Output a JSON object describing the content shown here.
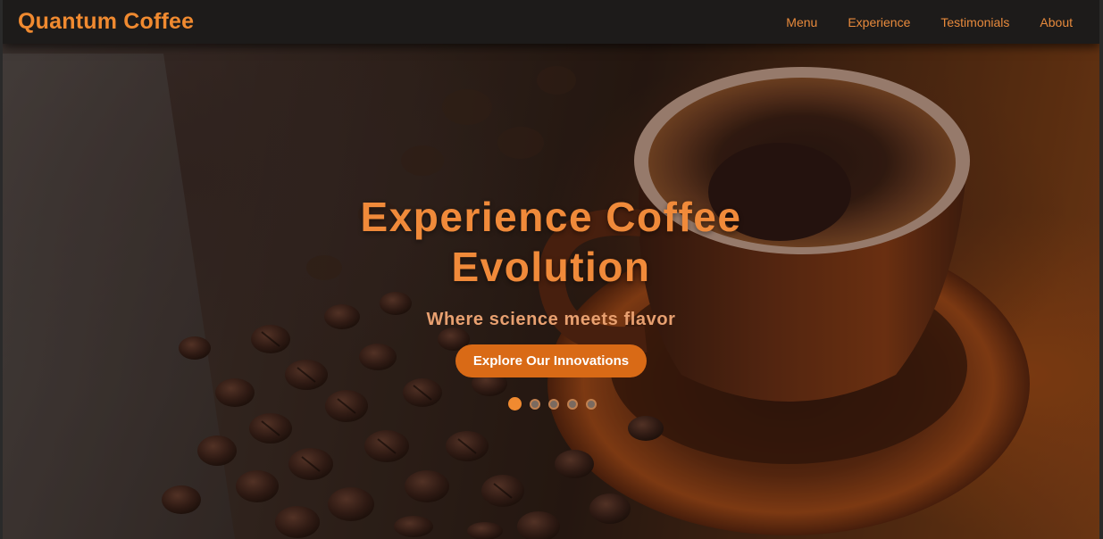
{
  "brand": {
    "name": "Quantum Coffee"
  },
  "nav": {
    "items": [
      {
        "label": "Menu"
      },
      {
        "label": "Experience"
      },
      {
        "label": "Testimonials"
      },
      {
        "label": "About"
      }
    ]
  },
  "hero": {
    "title": "Experience Coffee Evolution",
    "subtitle": "Where science meets flavor",
    "cta_label": "Explore Our Innovations",
    "slides": {
      "count": 5,
      "active_index": 0
    }
  },
  "colors": {
    "accent": "#f08a30",
    "cta_background": "#d96a16",
    "navbar_background": "#1d1b1a"
  },
  "icons": {
    "background": "coffee-cup-and-beans-image"
  }
}
